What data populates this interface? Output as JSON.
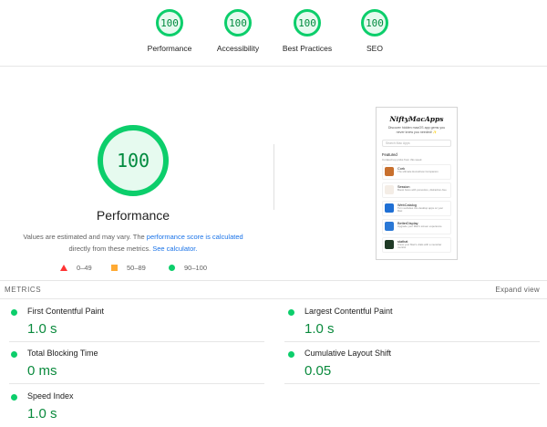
{
  "categories": [
    {
      "score": "100",
      "label": "Performance"
    },
    {
      "score": "100",
      "label": "Accessibility"
    },
    {
      "score": "100",
      "label": "Best Practices"
    },
    {
      "score": "100",
      "label": "SEO"
    }
  ],
  "performance": {
    "score": "100",
    "title": "Performance",
    "desc_part1": "Values are estimated and may vary. The ",
    "desc_link1": "performance score is calculated",
    "desc_part2": " directly from these metrics. ",
    "desc_link2": "See calculator."
  },
  "legend": {
    "fail": "0–49",
    "average": "50–89",
    "pass": "90–100"
  },
  "screenshot": {
    "logo": "NiftyMacApps",
    "subtitle": "Discover hidden macOS app gems you never knew you needed! ✨",
    "search_placeholder": "Search Mac Apps",
    "featured_title": "Featured",
    "featured_sub": "Curated top picks from this week",
    "apps": [
      {
        "name": "Cork",
        "desc": "The ultimate Homebrew Companion",
        "color": "#c8702e"
      },
      {
        "name": "Session",
        "desc": "Boost focus with pomodoro, distraction-free",
        "color": "#f4ede6"
      },
      {
        "name": "WebCatalog",
        "desc": "Turn websites into desktop apps on your Mac",
        "color": "#1f6fd4"
      },
      {
        "name": "BetterDisplay",
        "desc": "Upgrade your Mac's screen experience",
        "color": "#2a78d6"
      },
      {
        "name": "stathat",
        "desc": "Know your Mac's vitals with a menubar monitor",
        "color": "#1f3a26"
      }
    ]
  },
  "metrics": {
    "label": "METRICS",
    "expand_label": "Expand view",
    "items": [
      {
        "name": "First Contentful Paint",
        "value": "1.0 s"
      },
      {
        "name": "Largest Contentful Paint",
        "value": "1.0 s"
      },
      {
        "name": "Total Blocking Time",
        "value": "0 ms"
      },
      {
        "name": "Cumulative Layout Shift",
        "value": "0.05"
      },
      {
        "name": "Speed Index",
        "value": "1.0 s"
      }
    ]
  },
  "colors": {
    "pass": "#0cce6b",
    "average": "#ffaa33",
    "fail": "#ff3333",
    "link": "#1a73e8"
  }
}
